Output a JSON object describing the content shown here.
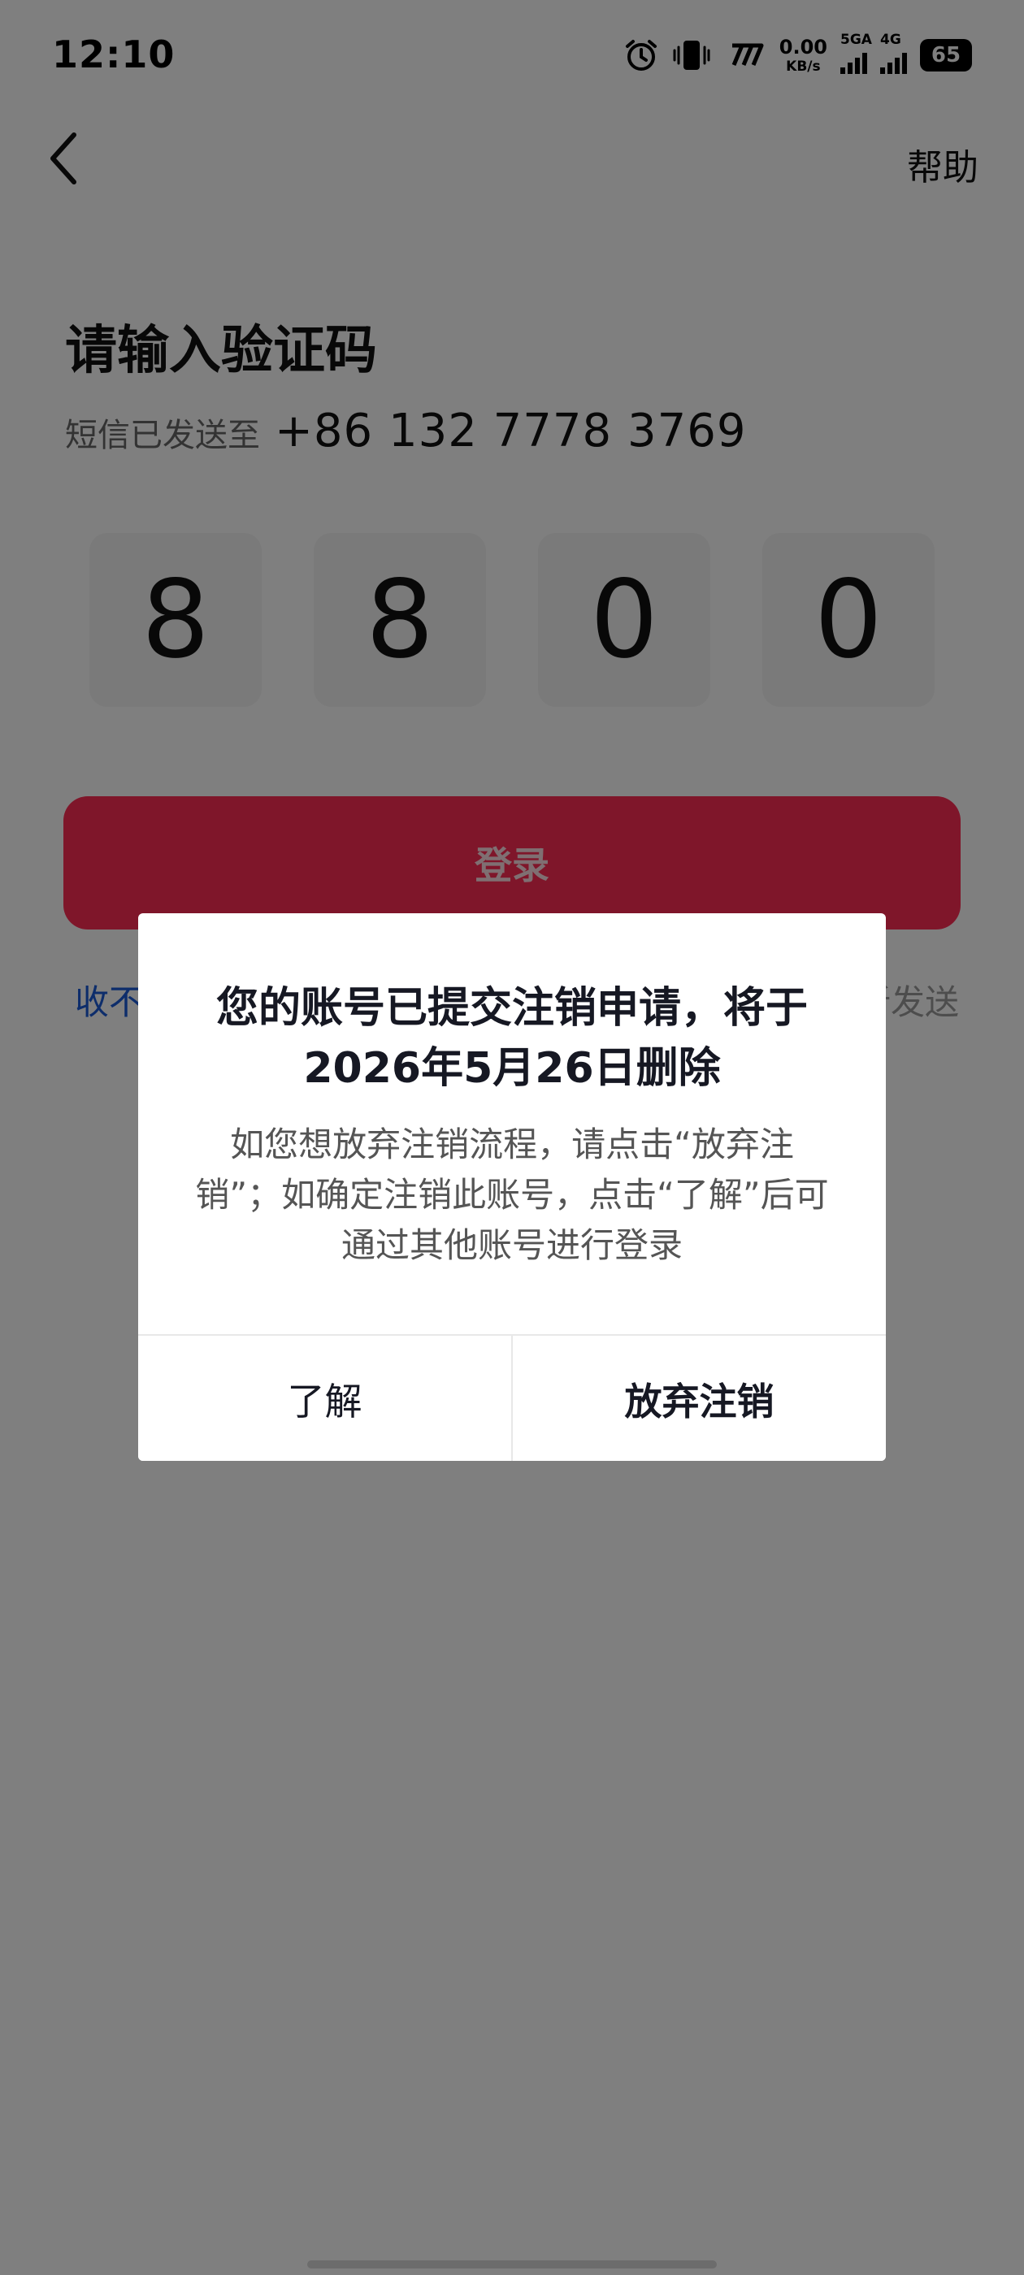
{
  "status_bar": {
    "time": "12:10",
    "network_speed_value": "0.00",
    "network_speed_unit": "KB/s",
    "signal1_label": "5GA",
    "signal2_label": "4G",
    "battery": "65",
    "icons": [
      "alarm-icon",
      "vibrate-icon",
      "nfc-icon",
      "signal-icon",
      "battery-icon"
    ]
  },
  "header": {
    "back_icon": "chevron-left-icon",
    "help_label": "帮助"
  },
  "main": {
    "title": "请输入验证码",
    "sent_label": "短信已发送至",
    "phone_number": "+86 132 7778 3769",
    "code_digits": [
      "8",
      "8",
      "0",
      "0"
    ],
    "login_button": "登录",
    "no_code_link": "收不到验证码",
    "resend_text": "重新发送"
  },
  "dialog": {
    "title": "您的账号已提交注销申请，将于2026年5月26日删除",
    "body": "如您想放弃注销流程，请点击“放弃注销”；如确定注销此账号，点击“了解”后可通过其他账号进行登录",
    "button_left": "了解",
    "button_right": "放弃注销"
  },
  "colors": {
    "accent": "#fe2c55",
    "link": "#1a5ad6",
    "overlay": "rgba(0,0,0,0.5)"
  }
}
